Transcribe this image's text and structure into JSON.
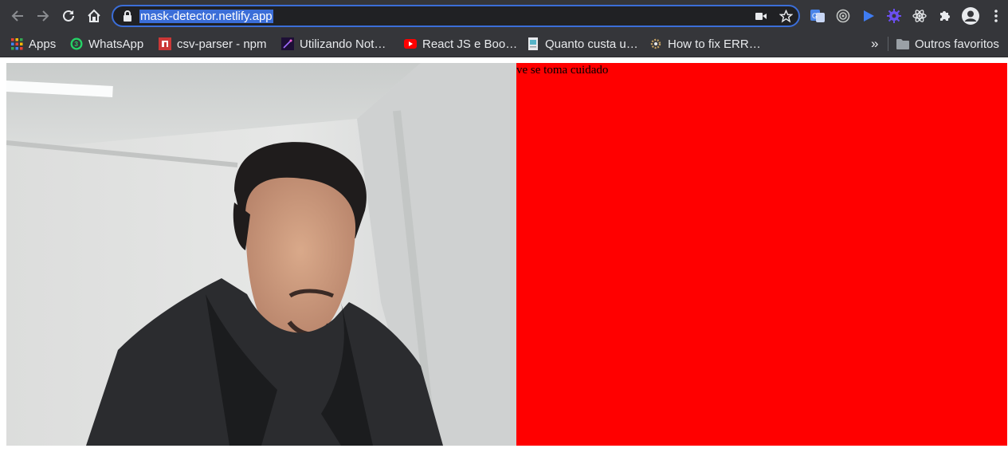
{
  "browser": {
    "url": "mask-detector.netlify.app"
  },
  "bookmarks": [
    {
      "label": "Apps",
      "icon": "apps-grid-icon"
    },
    {
      "label": "WhatsApp",
      "icon": "whatsapp-icon",
      "badge": "3"
    },
    {
      "label": "csv-parser - npm",
      "icon": "npm-icon"
    },
    {
      "label": "Utilizando Not…",
      "icon": "notion-icon"
    },
    {
      "label": "React JS e Boo…",
      "icon": "youtube-icon"
    },
    {
      "label": "Quanto custa u…",
      "icon": "document-icon"
    },
    {
      "label": "How to fix ERR…",
      "icon": "gear-icon"
    }
  ],
  "bookmarks_overflow": "»",
  "other_bookmarks": "Outros favoritos",
  "detector": {
    "message": "ve se toma cuidado",
    "status_color": "#ff0000"
  },
  "colors": {
    "accent": "#3b6ed8",
    "toolbar": "#35363a"
  }
}
